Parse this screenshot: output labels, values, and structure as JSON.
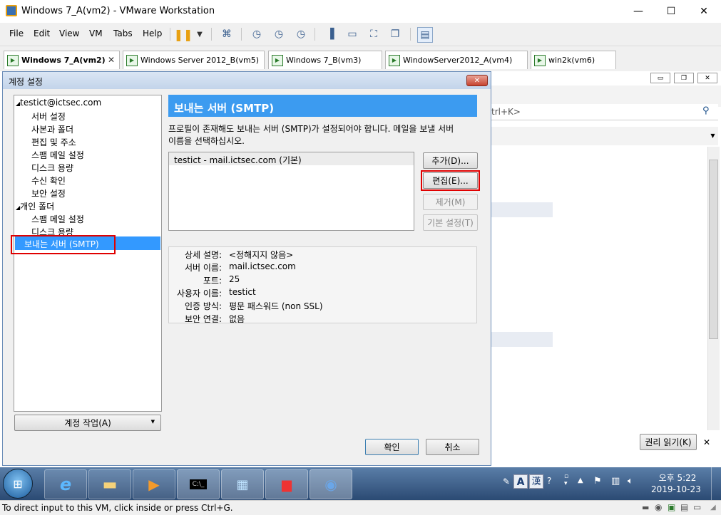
{
  "window": {
    "title": "Windows 7_A(vm2) - VMware Workstation",
    "minimize": "—",
    "maximize": "☐",
    "close": "✕"
  },
  "menu": [
    "File",
    "Edit",
    "View",
    "VM",
    "Tabs",
    "Help"
  ],
  "vm_tabs": [
    {
      "label": "Windows 7_A(vm2)",
      "active": true
    },
    {
      "label": "Windows Server 2012_B(vm5)"
    },
    {
      "label": "Windows 7_B(vm3)"
    },
    {
      "label": "WindowServer2012_A(vm4)"
    },
    {
      "label": "win2k(vm6)"
    }
  ],
  "dialog": {
    "title": "계정 설정",
    "tree": {
      "account": "testict@ictsec.com",
      "account_items": [
        "서버 설정",
        "사본과 폴더",
        "편집 및 주소",
        "스팸 메일 설정",
        "디스크 용량",
        "수신 확인",
        "보안 설정"
      ],
      "local_folders": "개인 폴더",
      "local_items": [
        "스팸 메일 설정",
        "디스크 용량"
      ],
      "smtp": "보내는 서버 (SMTP)"
    },
    "account_actions": "계정 작업(A)",
    "heading": "보내는 서버 (SMTP)",
    "description_line1": "프로필이 존재해도 보내는 서버 (SMTP)가 설정되어야 합니다. 메일을 보낼 서버",
    "description_line2": "이름을 선택하십시오.",
    "server_entry": "testict - mail.ictsec.com (기본)",
    "buttons": {
      "add": "추가(D)...",
      "edit": "편집(E)...",
      "remove": "제거(M)",
      "default": "기본 설정(T)",
      "ok": "확인",
      "cancel": "취소"
    },
    "details": [
      {
        "label": "상세 설명:",
        "value": "<정해지지 않음>"
      },
      {
        "label": "서버 이름:",
        "value": "mail.ictsec.com"
      },
      {
        "label": "포트:",
        "value": "25"
      },
      {
        "label": "사용자 이름:",
        "value": "testict"
      },
      {
        "label": "인증 방식:",
        "value": "평문 패스워드 (non SSL)"
      },
      {
        "label": "보안 연결:",
        "value": "없음"
      }
    ]
  },
  "background_app": {
    "search_hint": "trl+K>",
    "read_all_button": "권리 읽기(K)",
    "close": "✕"
  },
  "taskbar": {
    "ime_lang": "A",
    "ime_hanja": "漢",
    "time": "오후 5:22",
    "date": "2019-10-23"
  },
  "statusbar": {
    "message": "To direct input to this VM, click inside or press Ctrl+G."
  }
}
